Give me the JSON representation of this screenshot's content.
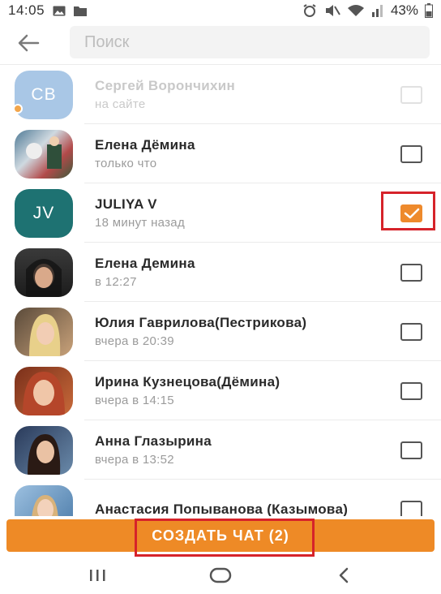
{
  "status_bar": {
    "time": "14:05",
    "battery": "43%"
  },
  "search": {
    "placeholder": "Поиск",
    "value": ""
  },
  "contacts": [
    {
      "initials": "СВ",
      "name": "Сергей Ворончихин",
      "status": "на сайте",
      "checked": false,
      "avatar_color": "#a9c7e6",
      "faded": true
    },
    {
      "initials": "",
      "name": "Елена Дёмина",
      "status": "только что",
      "checked": false,
      "avatar_color": "#6b8aa5"
    },
    {
      "initials": "JV",
      "name": "JULIYA V",
      "status": "18 минут назад",
      "checked": true,
      "avatar_color": "#1e7272"
    },
    {
      "initials": "",
      "name": "Елена Демина",
      "status": "в 12:27",
      "checked": false,
      "avatar_color": "#2c2c2c"
    },
    {
      "initials": "",
      "name": "Юлия Гаврилова(Пестрикова)",
      "status": "вчера в 20:39",
      "checked": false,
      "avatar_color": "#c89a6a"
    },
    {
      "initials": "",
      "name": "Ирина Кузнецова(Дёмина)",
      "status": "вчера в 14:15",
      "checked": false,
      "avatar_color": "#a0502a"
    },
    {
      "initials": "",
      "name": "Анна Глазырина",
      "status": "вчера в 13:52",
      "checked": false,
      "avatar_color": "#3c5a7a"
    },
    {
      "initials": "",
      "name": "Анастасия Попыванова (Казымова)",
      "status": "",
      "checked": false,
      "avatar_color": "#6c9ac8"
    }
  ],
  "action": {
    "create_label": "СОЗДАТЬ ЧАТ (2)"
  },
  "colors": {
    "accent": "#ee8a26",
    "highlight": "#d6232a"
  }
}
